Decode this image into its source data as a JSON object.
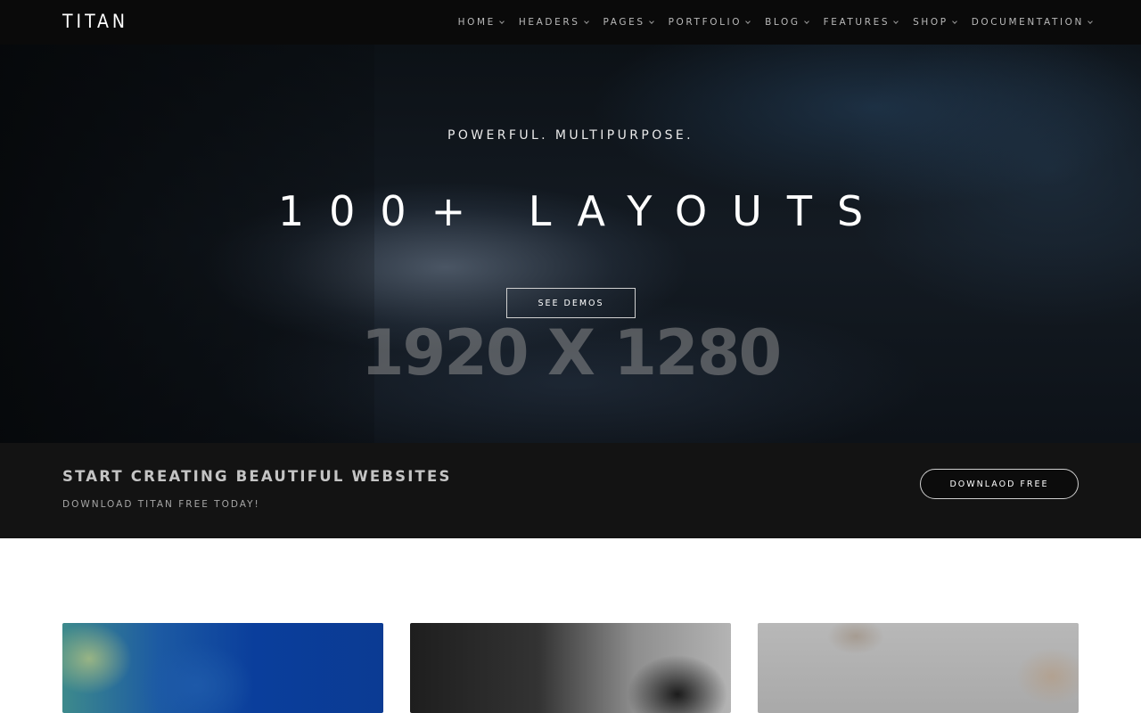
{
  "brand": "TITAN",
  "nav": {
    "items": [
      {
        "label": "HOME"
      },
      {
        "label": "HEADERS"
      },
      {
        "label": "PAGES"
      },
      {
        "label": "PORTFOLIO"
      },
      {
        "label": "BLOG"
      },
      {
        "label": "FEATURES"
      },
      {
        "label": "SHOP"
      },
      {
        "label": "DOCUMENTATION"
      }
    ]
  },
  "hero": {
    "subtitle": "POWERFUL. MULTIPURPOSE.",
    "title": "100+ LAYOUTS",
    "button_label": "SEE DEMOS",
    "placeholder_text": "1920 X 1280"
  },
  "cta": {
    "title": "START CREATING BEAUTIFUL WEBSITES",
    "subtitle": "DOWNLOAD TITAN FREE TODAY!",
    "button_label": "DOWNLAOD FREE"
  },
  "colors": {
    "navbar_bg": "#0a0a0a",
    "cta_bg": "#131313",
    "text_white": "#ffffff"
  }
}
